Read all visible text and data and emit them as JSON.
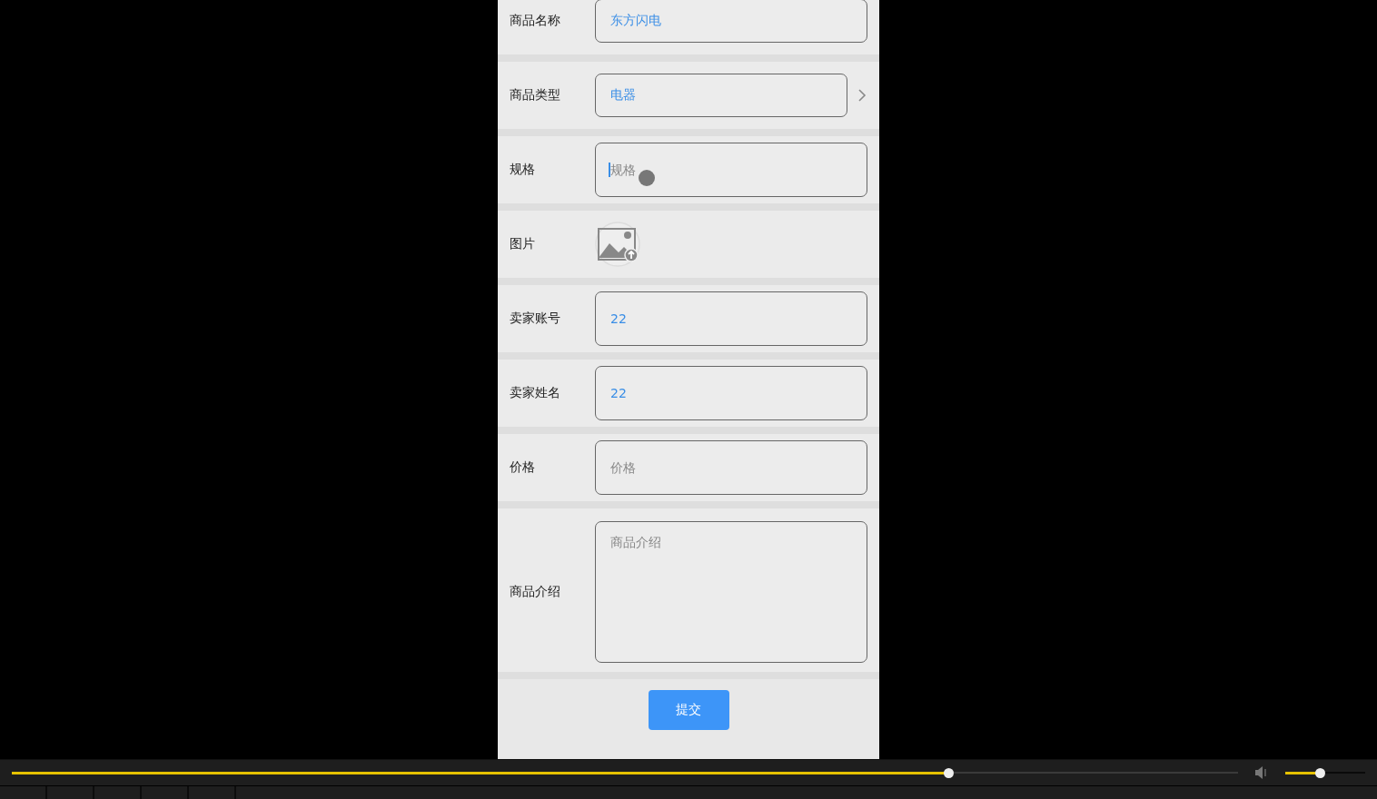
{
  "form": {
    "rows": [
      {
        "kind": "text",
        "label": "商品名称",
        "value": "东方闪电"
      },
      {
        "kind": "select",
        "label": "商品类型",
        "value": "电器"
      },
      {
        "kind": "text",
        "label": "规格",
        "placeholder": "规格",
        "focused": true
      },
      {
        "kind": "image",
        "label": "图片"
      },
      {
        "kind": "text",
        "label": "卖家账号",
        "value": "22"
      },
      {
        "kind": "text",
        "label": "卖家姓名",
        "value": "22"
      },
      {
        "kind": "text",
        "label": "价格",
        "placeholder": "价格"
      },
      {
        "kind": "textarea",
        "label": "商品介绍",
        "placeholder": "商品介绍"
      }
    ],
    "submit": "提交"
  },
  "player": {
    "progress": {
      "level": 0.764
    },
    "volume": {
      "level": 0.44
    }
  }
}
